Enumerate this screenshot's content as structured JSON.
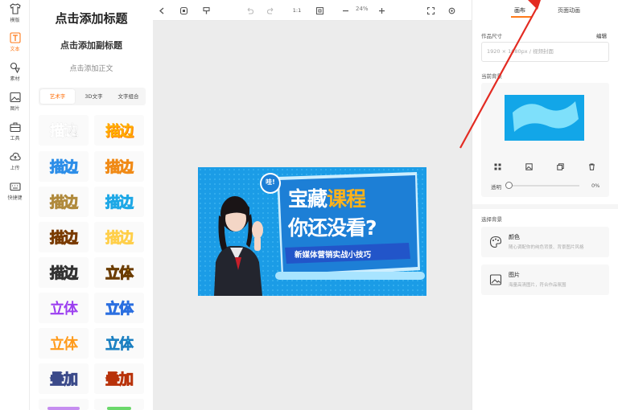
{
  "rail": {
    "items": [
      {
        "label": "模版",
        "icon": "shirt-icon"
      },
      {
        "label": "文本",
        "icon": "text-icon",
        "active": true
      },
      {
        "label": "素材",
        "icon": "shapes-icon"
      },
      {
        "label": "图片",
        "icon": "image-icon"
      },
      {
        "label": "工具",
        "icon": "toolbox-icon"
      },
      {
        "label": "上传",
        "icon": "cloud-upload-icon"
      },
      {
        "label": "快捷键",
        "icon": "keyboard-icon"
      }
    ]
  },
  "text_panel": {
    "add_title": "点击添加标题",
    "add_subtitle": "点击添加副标题",
    "add_body": "点击添加正文",
    "tabs": [
      "艺术字",
      "3D文字",
      "文字组合"
    ],
    "active_tab": 0,
    "tiles": [
      "描边",
      "描边",
      "描边",
      "描边",
      "描边",
      "描边",
      "描边",
      "描边",
      "描边",
      "描边",
      "描边",
      "立体",
      "立体",
      "立体",
      "立体",
      "立体",
      "叠加",
      "叠加"
    ]
  },
  "toolbar": {
    "ratio_label": "1:1",
    "zoom_label": "24%"
  },
  "poster": {
    "badge": "哇!",
    "line1_white": "宝藏",
    "line1_orange": "课程",
    "line2": "你还没看?",
    "banner": "新媒体营销实战小技巧"
  },
  "right_panel": {
    "tabs": [
      "画布",
      "页面动画"
    ],
    "size_label": "作品尺寸",
    "edit_link": "编辑",
    "size_value": "1920 × 1080px  / 视频封面",
    "current_bg_label": "当前背景",
    "opacity_label": "透明",
    "opacity_value": "0%",
    "choose_bg_label": "选择背景",
    "options": [
      {
        "title": "颜色",
        "desc": "随心调配你的纯色背景、背景图片风格"
      },
      {
        "title": "图片",
        "desc": "海量高清图片，符合作品氛围"
      }
    ]
  },
  "colors": {
    "accent": "#ff7a1a",
    "poster_bg": "#1b9ce6",
    "poster_title_orange": "#ffb21a"
  }
}
